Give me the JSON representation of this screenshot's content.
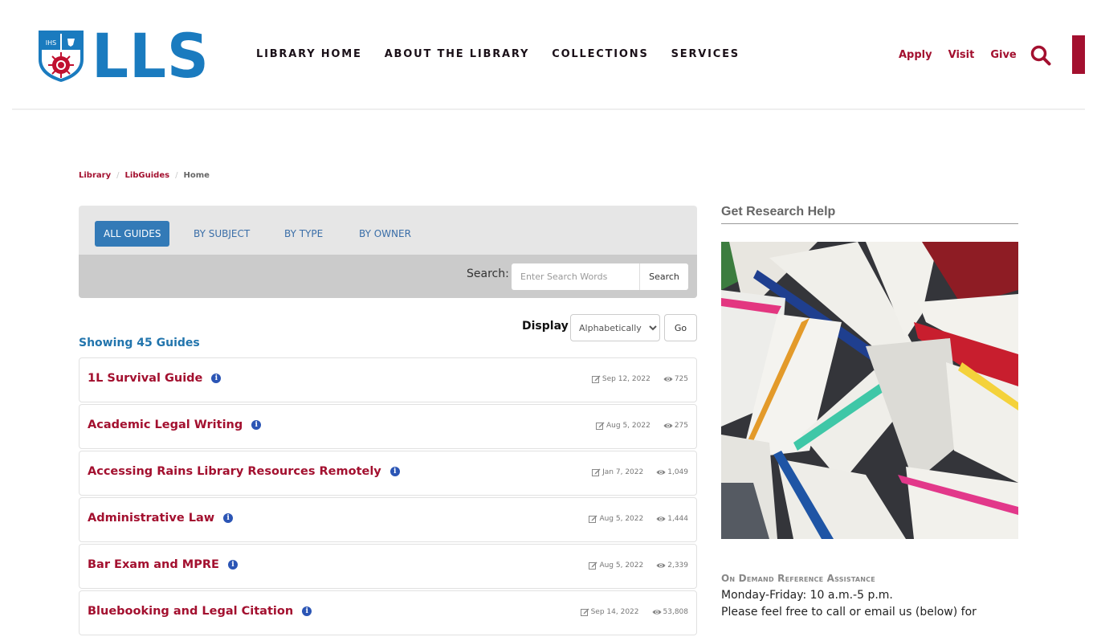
{
  "header": {
    "logo_text": "LLS",
    "main_nav": [
      "LIBRARY HOME",
      "ABOUT THE LIBRARY",
      "COLLECTIONS",
      "SERVICES"
    ],
    "util_nav": [
      "Apply",
      "Visit",
      "Give"
    ],
    "brand_red": "#a3102f",
    "brand_blue": "#1a7bbf"
  },
  "breadcrumb": {
    "items": [
      "Library",
      "LibGuides"
    ],
    "current": "Home"
  },
  "guide_panel": {
    "tabs": [
      {
        "label": "ALL GUIDES",
        "active": true
      },
      {
        "label": "BY SUBJECT",
        "active": false
      },
      {
        "label": "BY TYPE",
        "active": false
      },
      {
        "label": "BY OWNER",
        "active": false
      }
    ],
    "search_label": "Search:",
    "search_placeholder": "Enter Search Words",
    "search_value": "",
    "search_button": "Search"
  },
  "display": {
    "label": "Display",
    "selected": "Alphabetically",
    "go_button": "Go"
  },
  "showing": "Showing 45 Guides",
  "guides": [
    {
      "title": "1L Survival Guide",
      "date": "Sep 12, 2022",
      "views": "725"
    },
    {
      "title": "Academic Legal Writing",
      "date": "Aug 5, 2022",
      "views": "275"
    },
    {
      "title": "Accessing Rains Library Resources Remotely",
      "date": "Jan 7, 2022",
      "views": "1,049"
    },
    {
      "title": "Administrative Law",
      "date": "Aug 5, 2022",
      "views": "1,444"
    },
    {
      "title": "Bar Exam and MPRE",
      "date": "Aug 5, 2022",
      "views": "2,339"
    },
    {
      "title": "Bluebooking and Legal Citation",
      "date": "Sep 14, 2022",
      "views": "53,808"
    }
  ],
  "sidebar": {
    "title": "Get Research Help",
    "image_alt": "stack-of-open-books",
    "heading": "On Demand Reference Assistance",
    "hours": "Monday-Friday: 10 a.m.-5 p.m.",
    "text": "Please feel free to call or email us (below) for"
  }
}
